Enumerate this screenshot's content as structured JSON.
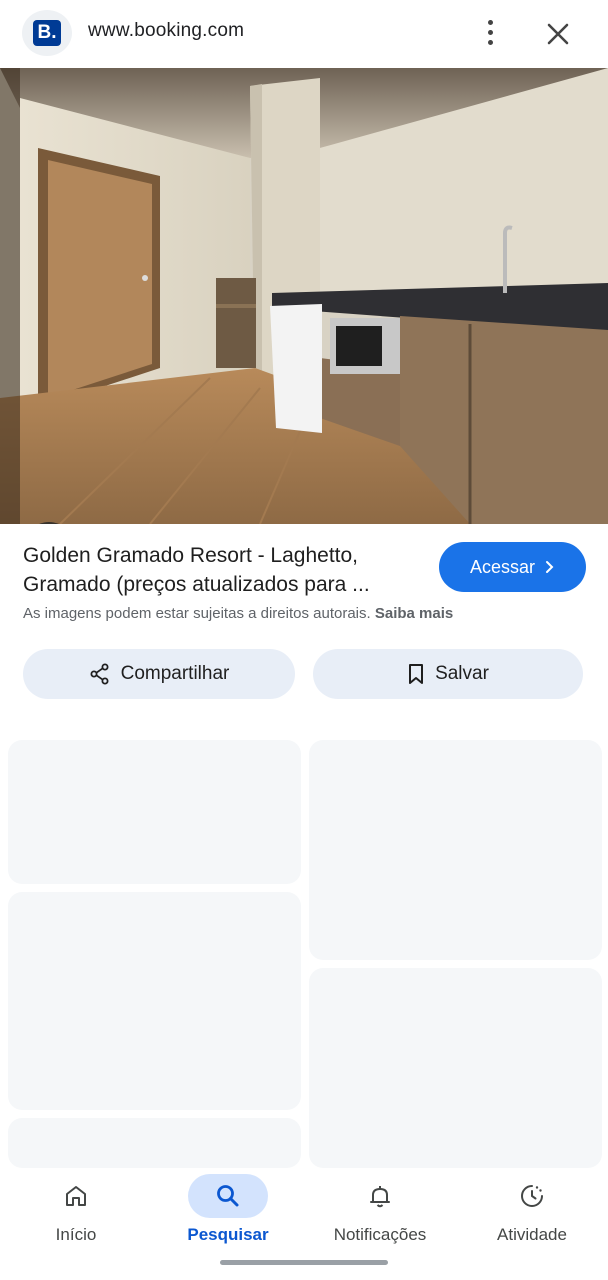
{
  "header": {
    "site_logo_letter": "B.",
    "site_url": "www.booking.com",
    "more_icon": "more-vert-icon",
    "close_icon": "close-icon"
  },
  "hero": {
    "image_subject": "kitchenette-room-photo",
    "lens_icon": "lens-icon"
  },
  "result": {
    "title": "Golden Gramado Resort - Laghetto, Gramado (preços atualizados para ...",
    "access_label": "Acessar",
    "access_icon": "chevron-right-icon",
    "copyright_text": "As imagens podem estar sujeitas a direitos autorais.",
    "learn_more": "Saiba mais"
  },
  "actions": {
    "share_label": "Compartilhar",
    "share_icon": "share-icon",
    "save_label": "Salvar",
    "save_icon": "bookmark-icon"
  },
  "bottom_nav": {
    "items": [
      {
        "label": "Início",
        "icon": "home-icon",
        "active": false
      },
      {
        "label": "Pesquisar",
        "icon": "search-icon",
        "active": true
      },
      {
        "label": "Notificações",
        "icon": "bell-icon",
        "active": false
      },
      {
        "label": "Atividade",
        "icon": "history-icon",
        "active": false
      }
    ]
  },
  "colors": {
    "accent": "#1a73e8",
    "brand": "#003b95",
    "pill_bg": "#e8eef7",
    "active_nav_bg": "#d3e3fd"
  }
}
